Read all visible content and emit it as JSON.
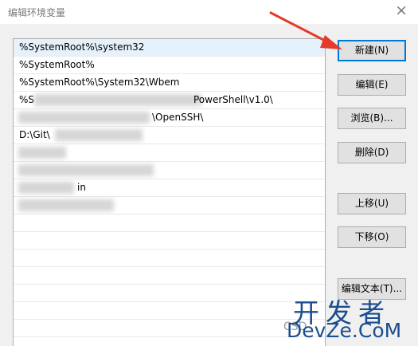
{
  "window": {
    "title": "编辑环境变量",
    "close_glyph": "×"
  },
  "path_list": {
    "entries": [
      {
        "text": "%SystemRoot%\\system32",
        "selected": true
      },
      {
        "text": "%SystemRoot%",
        "selected": false
      },
      {
        "text": "%SystemRoot%\\System32\\Wbem",
        "selected": false
      },
      {
        "text": "%S",
        "tail": "PowerShell\\v1.0\\",
        "selected": false
      },
      {
        "text": "",
        "tail": "\\OpenSSH\\",
        "selected": false
      },
      {
        "text": "D:\\Git\\",
        "tail": "",
        "selected": false
      },
      {
        "text": "",
        "tail": "",
        "selected": false
      },
      {
        "text": "",
        "tail": "",
        "selected": false
      },
      {
        "text": "",
        "tail": "in",
        "selected": false
      },
      {
        "text": "",
        "tail": "",
        "selected": false
      }
    ]
  },
  "buttons": {
    "new": "新建(N)",
    "edit": "编辑(E)",
    "browse": "浏览(B)...",
    "delete": "删除(D)",
    "move_up": "上移(U)",
    "move_down": "下移(O)",
    "edit_text": "编辑文本(T)..."
  },
  "watermark": {
    "cn": "开发者",
    "en": "DevZe.CoM",
    "faint": "CSD"
  },
  "colors": {
    "selected_row": "#e5f1fb",
    "primary_border": "#0078d7",
    "arrow": "#e53b2c",
    "watermark": "#1b4d8f"
  }
}
